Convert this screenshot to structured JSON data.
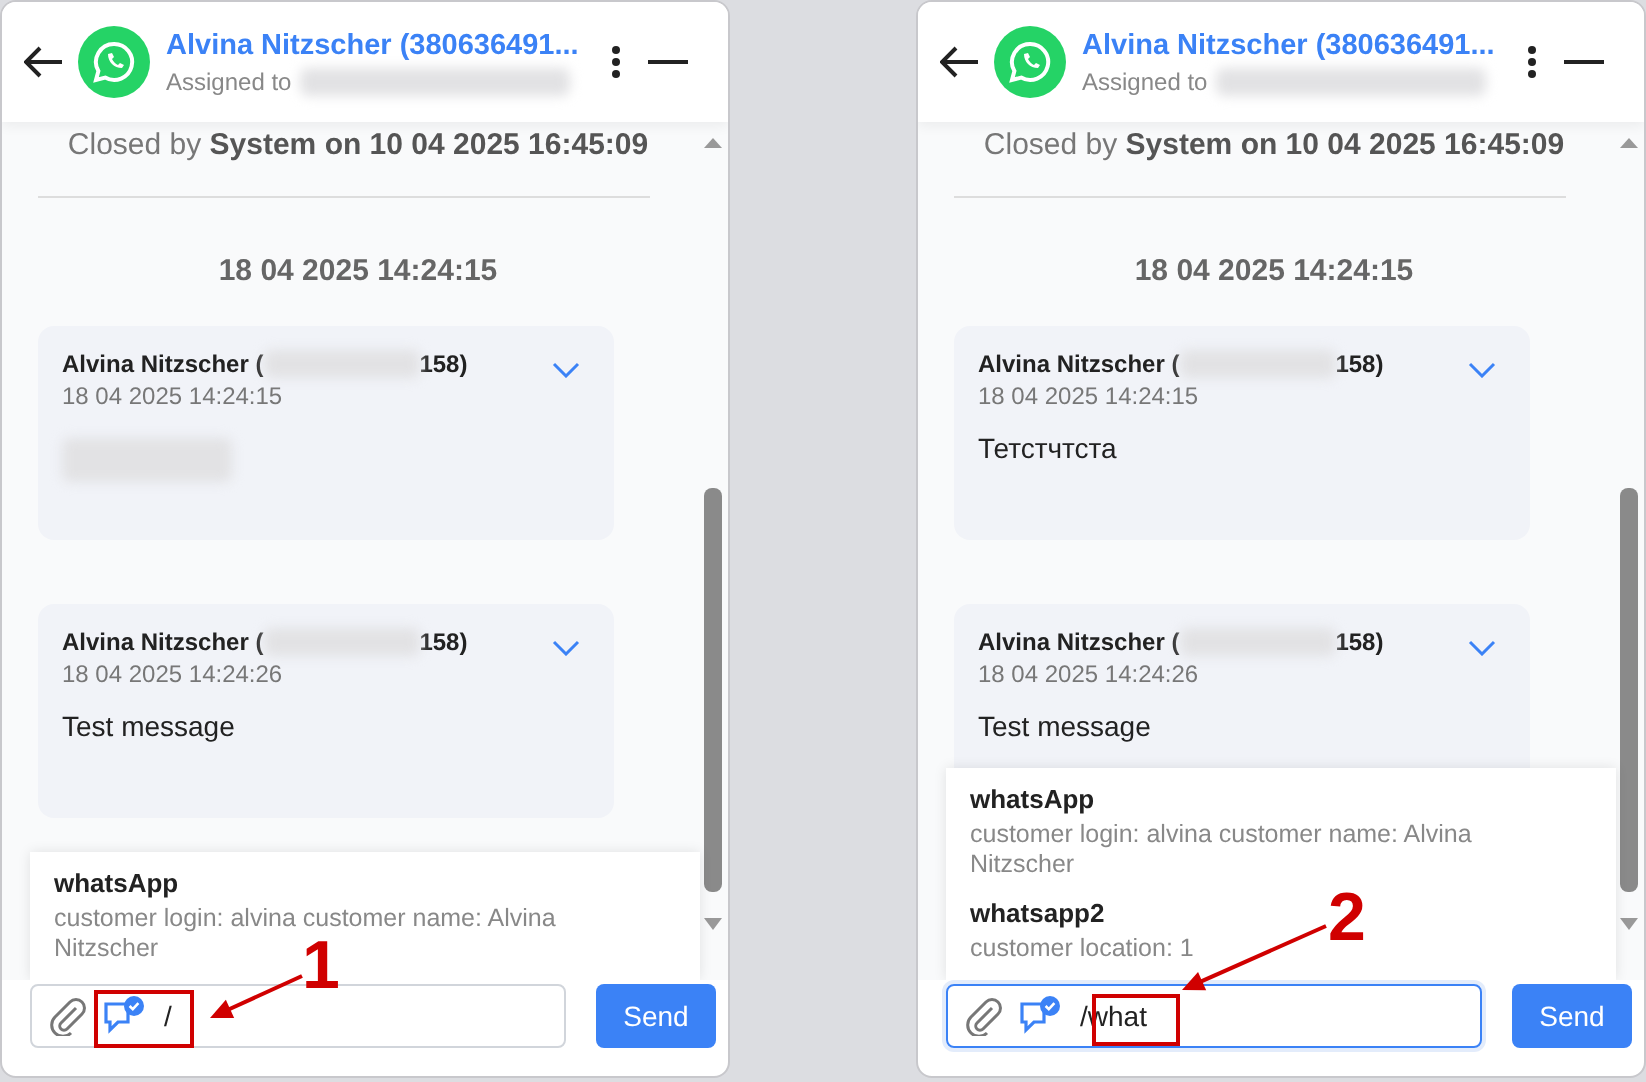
{
  "panels": [
    {
      "header": {
        "title": "Alvina Nitzscher (380636491...",
        "assigned_label": "Assigned to"
      },
      "closed_note": "Closed by **System on 10 04 2025 16:45:09**",
      "date_separator": "18 04 2025 14:24:15",
      "messages": [
        {
          "sender": "Alvina Nitzscher (",
          "sender_suffix": "158)",
          "time": "18 04 2025 14:24:15",
          "body_blurred": true
        },
        {
          "sender": "Alvina Nitzscher (",
          "sender_suffix": "158)",
          "time": "18 04 2025 14:24:26",
          "text": "Test message",
          "body_blurred": false
        }
      ],
      "suggestions": [
        {
          "title": "whatsApp",
          "description": "customer login: alvina customer name: Alvina Nitzscher"
        }
      ],
      "composer": {
        "value": "/",
        "focused": false,
        "send_label": "Send"
      },
      "annotation": {
        "number": "1"
      }
    },
    {
      "header": {
        "title": "Alvina Nitzscher (380636491...",
        "assigned_label": "Assigned to"
      },
      "closed_note": "Closed by **System on 10 04 2025 16:45:09**",
      "date_separator": "18 04 2025 14:24:15",
      "messages": [
        {
          "sender": "Alvina Nitzscher (",
          "sender_suffix": "158)",
          "time": "18 04 2025 14:24:15",
          "text": "Тетстчтста",
          "body_blurred": false
        },
        {
          "sender": "Alvina Nitzscher (",
          "sender_suffix": "158)",
          "time": "18 04 2025 14:24:26",
          "text": "Test message",
          "body_blurred": false
        }
      ],
      "suggestions": [
        {
          "title": "whatsApp",
          "description": "customer login: alvina customer name: Alvina Nitzscher"
        },
        {
          "title": "whatsapp2",
          "description": "customer location: 1"
        }
      ],
      "composer": {
        "value": "/what",
        "focused": true,
        "send_label": "Send"
      },
      "annotation": {
        "number": "2"
      }
    }
  ]
}
